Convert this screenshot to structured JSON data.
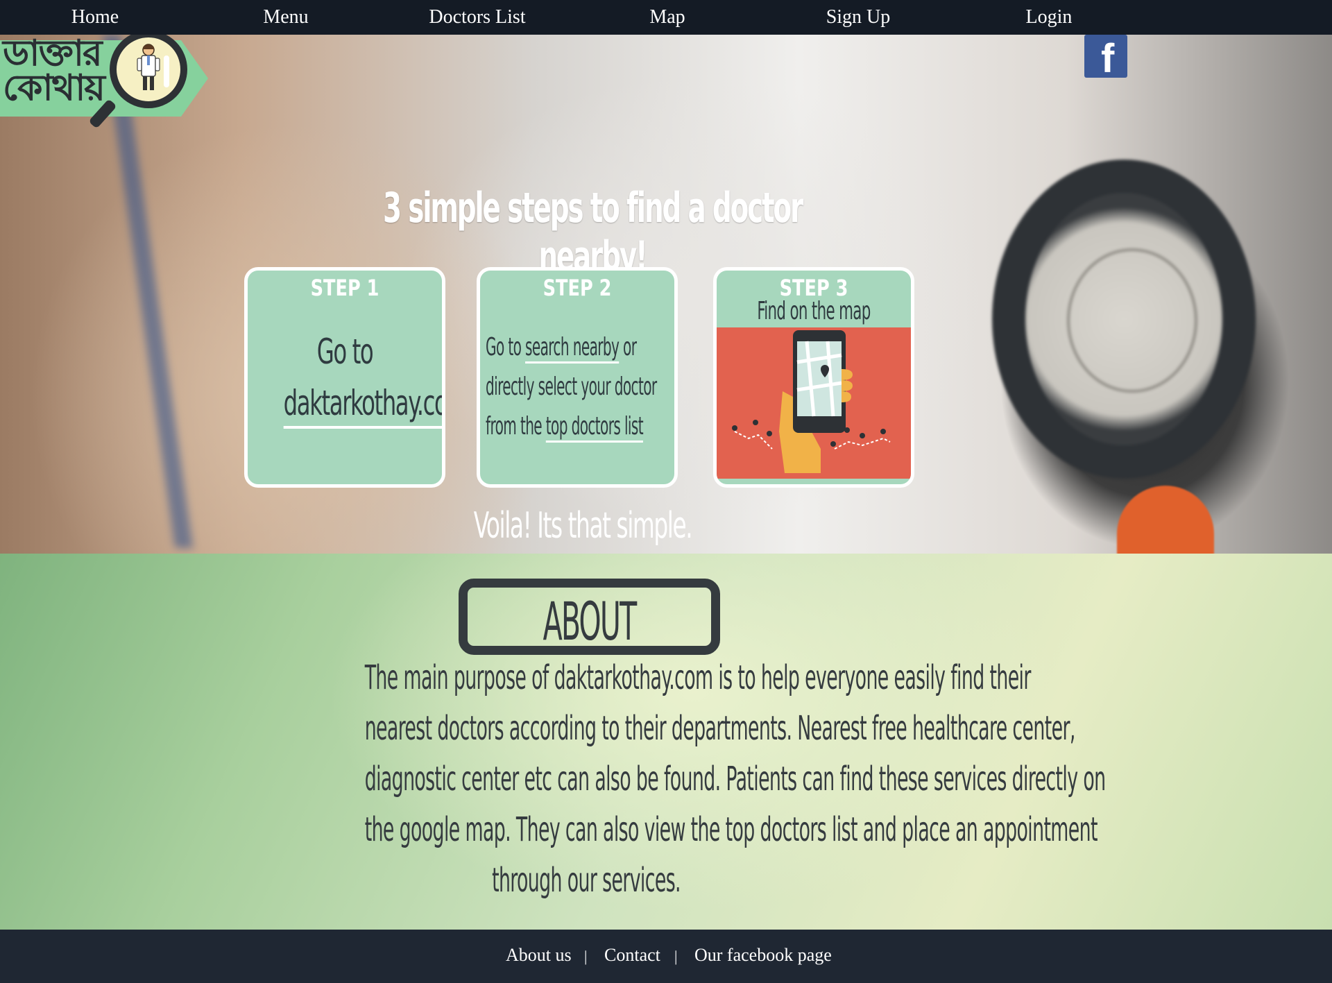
{
  "nav": {
    "items": [
      {
        "label": "Home"
      },
      {
        "label": "Menu"
      },
      {
        "label": "Doctors List"
      },
      {
        "label": "Map"
      },
      {
        "label": "Sign Up"
      },
      {
        "label": "Login"
      }
    ]
  },
  "logo": {
    "text_line1": "ডাক্তার",
    "text_line2": "কোথায়",
    "icon": "magnifier-doctor-icon"
  },
  "social": {
    "facebook_glyph": "f",
    "facebook_color": "#3b5998"
  },
  "hero": {
    "title": "3 simple steps to find a doctor nearby!",
    "steps": [
      {
        "label": "STEP 1",
        "line1": "Go to",
        "link": "daktarkothay.com"
      },
      {
        "label": "STEP 2",
        "prefix": "Go to ",
        "link1": "search nearby",
        "mid1": " or",
        "line2": "directly select your doctor",
        "pre3": "from the ",
        "link2": "top doctors list"
      },
      {
        "label": "STEP 3",
        "sub": "Find on the map",
        "image": "phone-map-illustration"
      }
    ],
    "outro": "Voila! Its that simple."
  },
  "about": {
    "title": "ABOUT",
    "lines": [
      "The main purpose of daktarkothay.com is to help everyone easily find their",
      "nearest doctors according to their departments. Nearest free healthcare center,",
      "diagnostic center etc can also be found. Patients can find these services directly on",
      "the google map. They can also view the top doctors list and place an appointment",
      "through our services."
    ]
  },
  "footer": {
    "links": [
      {
        "label": "About us"
      },
      {
        "label": "Contact"
      },
      {
        "label": "Our facebook page"
      }
    ],
    "separator": "|"
  },
  "colors": {
    "nav_bg": "#141b25",
    "card_bg": "#a7d7bd",
    "card_border": "#ffffff",
    "map_bg": "#e2624f",
    "text_dark": "#2f3b40",
    "footer_bg": "#1f2733"
  }
}
